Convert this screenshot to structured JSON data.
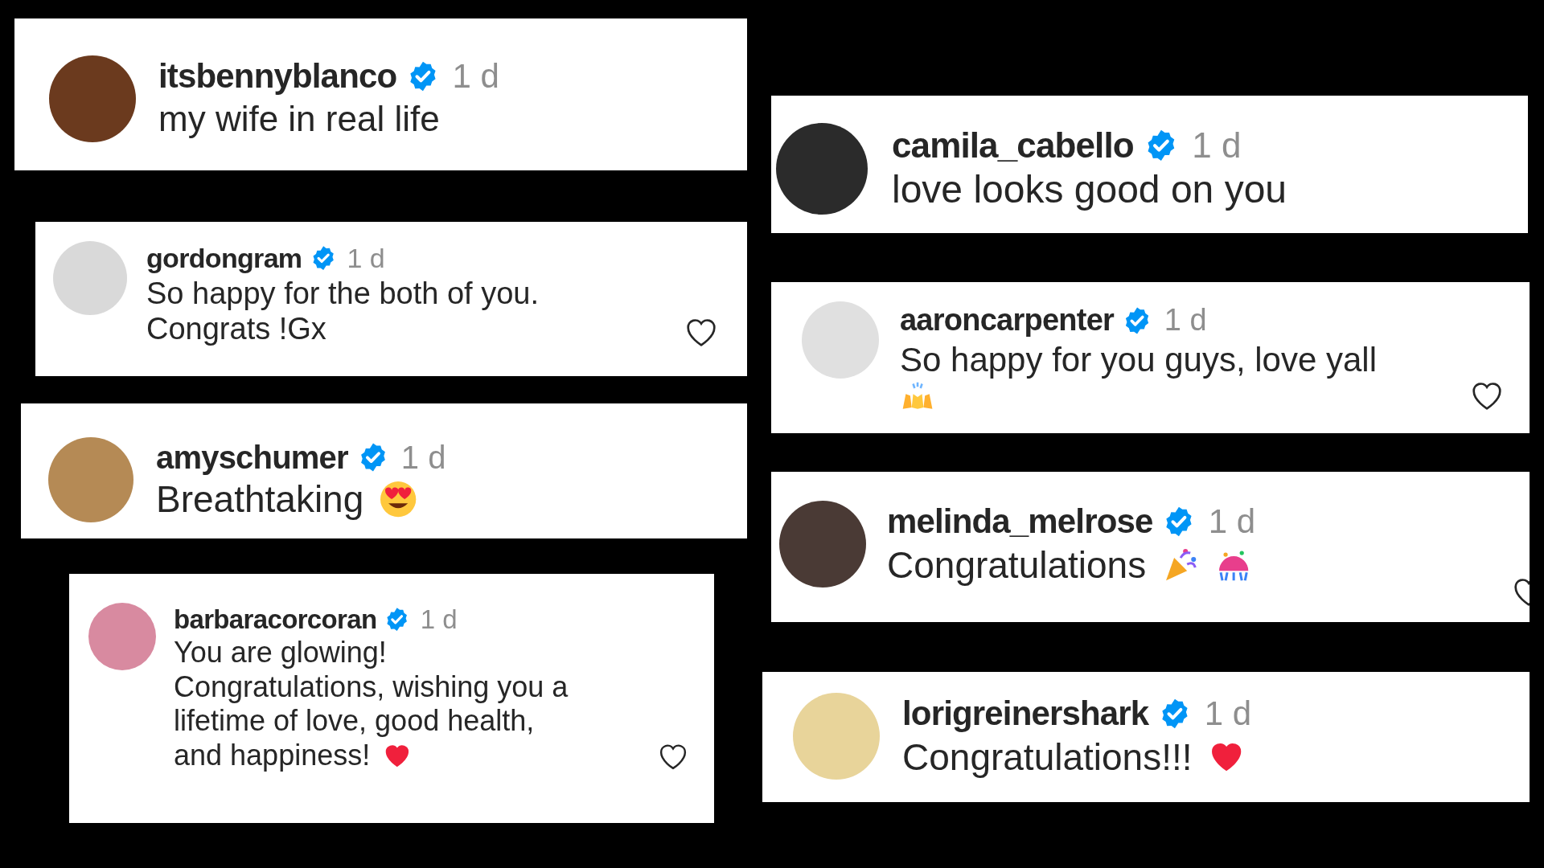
{
  "left_column": [
    {
      "username": "itsbennyblanco",
      "time": "1 d",
      "lines": [
        "my wife in real life"
      ]
    },
    {
      "username": "gordongram",
      "time": "1 d",
      "lines": [
        "So happy for the both of you.",
        "Congrats !Gx"
      ]
    },
    {
      "username": "amyschumer",
      "time": "1 d",
      "lines": [
        "Breathtaking"
      ]
    },
    {
      "username": "barbaracorcoran",
      "time": "1 d",
      "lines": [
        "You are glowing!",
        "Congratulations, wishing you a",
        "lifetime of love, good health,",
        "and happiness!"
      ]
    }
  ],
  "right_column": [
    {
      "username": "camila_cabello",
      "time": "1 d",
      "lines": [
        "love looks good on you"
      ]
    },
    {
      "username": "aaroncarpenter",
      "time": "1 d",
      "lines": [
        "So happy for you guys, love yall"
      ]
    },
    {
      "username": "melinda_melrose",
      "time": "1 d",
      "lines": [
        "Congratulations"
      ]
    },
    {
      "username": "lorigreinershark",
      "time": "1 d",
      "lines": [
        "Congratulations!!!"
      ]
    }
  ]
}
